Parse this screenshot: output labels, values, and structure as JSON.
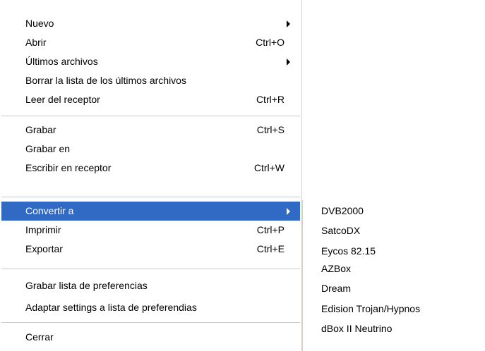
{
  "file_menu": {
    "items": [
      {
        "label": "Nuevo",
        "shortcut": "",
        "submenu_arrow": true
      },
      {
        "label": "Abrir",
        "shortcut": "Ctrl+O",
        "submenu_arrow": false
      },
      {
        "label": "Últimos archivos",
        "shortcut": "",
        "submenu_arrow": true
      },
      {
        "label": "Borrar la lista de los últimos archivos",
        "shortcut": "",
        "submenu_arrow": false
      },
      {
        "label": "Leer del receptor",
        "shortcut": "Ctrl+R",
        "submenu_arrow": false
      },
      {
        "label": "Grabar",
        "shortcut": "Ctrl+S",
        "submenu_arrow": false
      },
      {
        "label": "Grabar en",
        "shortcut": "",
        "submenu_arrow": false
      },
      {
        "label": "Escribir en receptor",
        "shortcut": "Ctrl+W",
        "submenu_arrow": false
      },
      {
        "label": "Convertir a",
        "shortcut": "",
        "submenu_arrow": true,
        "highlighted": true
      },
      {
        "label": "Imprimir",
        "shortcut": "Ctrl+P",
        "submenu_arrow": false
      },
      {
        "label": "Exportar",
        "shortcut": "Ctrl+E",
        "submenu_arrow": false
      },
      {
        "label": "Grabar lista de preferencias",
        "shortcut": "",
        "submenu_arrow": false
      },
      {
        "label": "Adaptar settings a lista de preferendias",
        "shortcut": "",
        "submenu_arrow": false
      },
      {
        "label": "Cerrar",
        "shortcut": "",
        "submenu_arrow": false
      }
    ]
  },
  "convert_submenu": {
    "items": [
      {
        "label": "DVB2000"
      },
      {
        "label": "SatcoDX"
      },
      {
        "label": "Eycos 82.15"
      },
      {
        "label": "AZBox"
      },
      {
        "label": "Dream"
      },
      {
        "label": "Edision Trojan/Hypnos"
      },
      {
        "label": "dBox II Neutrino"
      }
    ]
  },
  "colors": {
    "highlight": "#316ac5",
    "highlight_text": "#ffffff",
    "separator": "#c8c8c8",
    "background": "#ffffff"
  }
}
